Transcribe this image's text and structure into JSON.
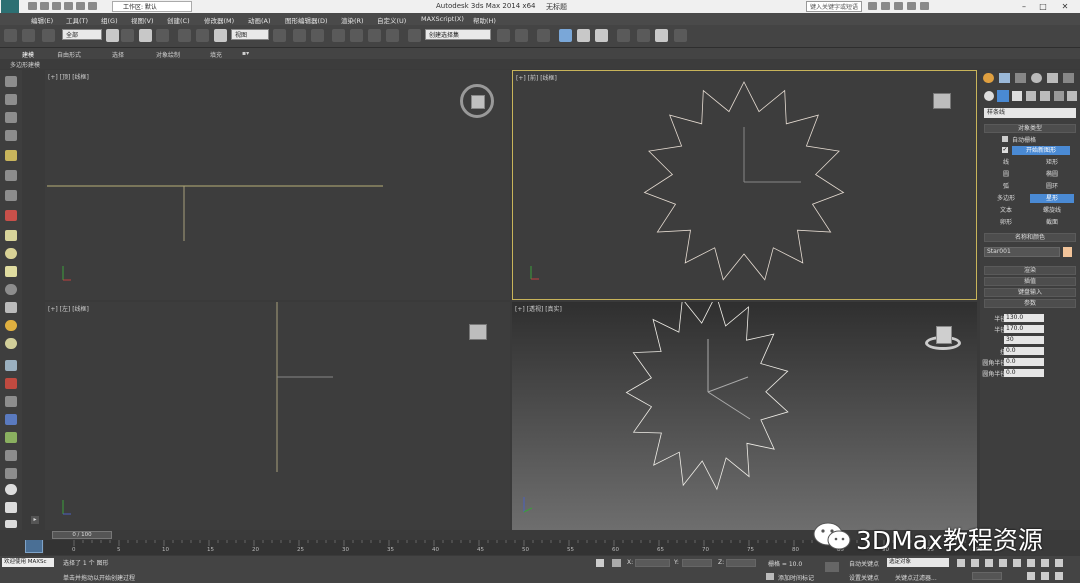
{
  "window": {
    "app_title": "Autodesk 3ds Max 2014 x64",
    "doc_title": "无标题",
    "workspace": "工作区: 默认",
    "search_placeholder": "键入关键字或短语"
  },
  "menu": {
    "items": [
      "编辑(E)",
      "工具(T)",
      "组(G)",
      "视图(V)",
      "创建(C)",
      "修改器(M)",
      "动画(A)",
      "图形编辑器(D)",
      "渲染(R)",
      "自定义(U)",
      "MAXScript(X)",
      "帮助(H)"
    ]
  },
  "toolbar": {
    "selection_filter": "全部",
    "coord_system": "视图",
    "named_selection": "创建选择集"
  },
  "ribbon": {
    "tabs": [
      "建模",
      "自由形式",
      "选择",
      "对象绘制",
      "填充"
    ],
    "panel_label": "多边形建模"
  },
  "viewports": {
    "top": "[+] [顶] [线框]",
    "front": "[+] [前] [线框]",
    "left": "[+] [左] [线框]",
    "perspective": "[+] [透视] [真实]"
  },
  "command_panel": {
    "category": "样条线",
    "object_type_title": "对象类型",
    "auto_grid": "自动栅格",
    "start_new_shape": "开始新图形",
    "buttons": [
      "线",
      "矩形",
      "圆",
      "椭圆",
      "弧",
      "圆环",
      "多边形",
      "星形",
      "文本",
      "螺旋线",
      "卵形",
      "截面"
    ],
    "name_color_title": "名称和颜色",
    "object_name": "Star001",
    "object_color": "#f2c49a",
    "rollouts": [
      "渲染",
      "插值",
      "键盘输入"
    ],
    "params_title": "参数",
    "params": [
      {
        "label": "半径 1:",
        "value": "130.0"
      },
      {
        "label": "半径 2:",
        "value": "170.0"
      },
      {
        "label": "点:",
        "value": "30"
      },
      {
        "label": "扭曲:",
        "value": "0.0"
      },
      {
        "label": "圆角半径 1:",
        "value": "0.0"
      },
      {
        "label": "圆角半径 2:",
        "value": "0.0"
      }
    ]
  },
  "timeline": {
    "frame_display": "0 / 100",
    "ticks": [
      "0",
      "5",
      "10",
      "15",
      "20",
      "25",
      "30",
      "35",
      "40",
      "45",
      "50",
      "55",
      "60",
      "65",
      "70",
      "75",
      "80",
      "85",
      "90",
      "95",
      "100"
    ]
  },
  "status": {
    "welcome": "欢迎使用 MAXSc",
    "selected": "选择了 1 个 图形",
    "prompt": "单击并拖动以开始创建过程",
    "x_label": "X:",
    "y_label": "Y:",
    "z_label": "Z:",
    "grid": "栅格 = 10.0",
    "add_time_tag": "添加时间标记",
    "auto_key": "自动关键点",
    "set_key": "设置关键点",
    "selected_object": "选定对象",
    "key_filters": "关键点过滤器..."
  },
  "watermark": {
    "text": "3DMax教程资源"
  },
  "colors": {
    "active_viewport_border": "#c8b45a",
    "selected_button": "#4a8ad4",
    "star_color": "#f0eee8"
  }
}
